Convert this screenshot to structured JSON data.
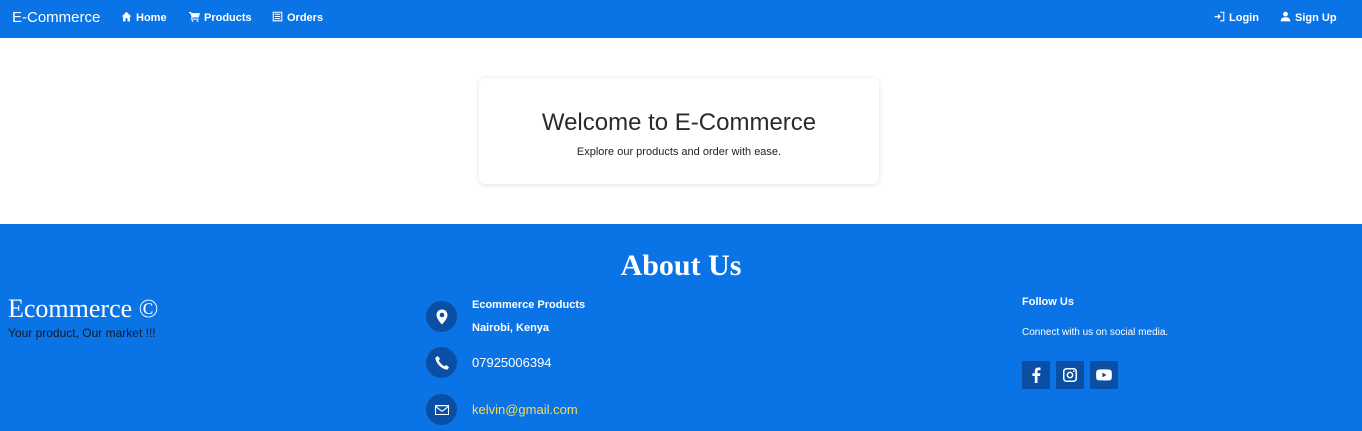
{
  "navbar": {
    "brand": "E-Commerce",
    "links": {
      "home": "Home",
      "products": "Products",
      "orders": "Orders"
    },
    "auth": {
      "login": "Login",
      "signup": "Sign Up"
    },
    "color": "#0a73e6"
  },
  "hero": {
    "title": "Welcome to E-Commerce",
    "subtitle": "Explore our products and order with ease."
  },
  "footer": {
    "about_title": "About Us",
    "brand": "Ecommerce ©",
    "tagline": "Your product, Our market !!!",
    "contact": {
      "company": "Ecommerce Products",
      "location": "Nairobi, Kenya",
      "phone": "07925006394",
      "email": "kelvin@gmail.com"
    },
    "follow": {
      "title": "Follow Us",
      "text": "Connect with us on social media.",
      "icons": [
        "facebook-icon",
        "instagram-icon",
        "youtube-icon"
      ]
    },
    "color": "#0a73e6",
    "email_color": "#ffd84d"
  }
}
